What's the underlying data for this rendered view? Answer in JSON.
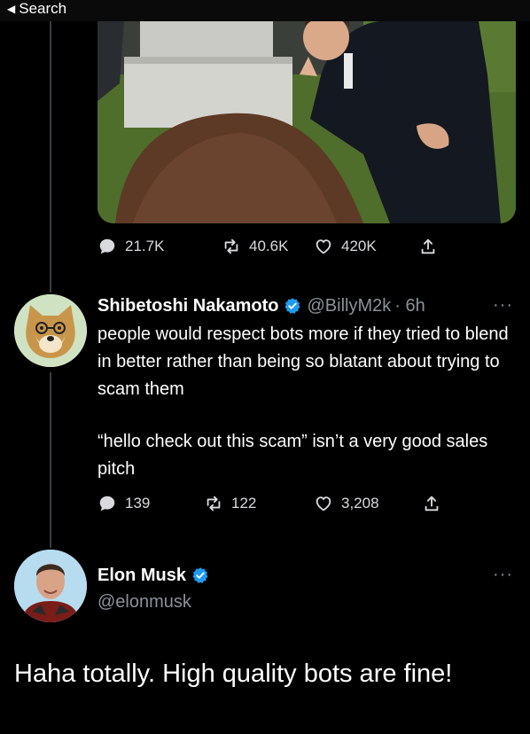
{
  "statusbar": {
    "back_label": "Search"
  },
  "first_tweet": {
    "stats": {
      "replies": "21.7K",
      "retweets": "40.6K",
      "likes": "420K"
    }
  },
  "reply_tweet": {
    "display_name": "Shibetoshi Nakamoto",
    "handle": "@BillyM2k",
    "time": "· 6h",
    "more": "···",
    "paragraph1": "people would respect bots more if they tried to blend in better rather than being so blatant about trying to scam them",
    "paragraph2": "“hello check out this scam” isn’t a very good sales pitch",
    "stats": {
      "replies": "139",
      "retweets": "122",
      "likes": "3,208"
    }
  },
  "main_tweet": {
    "display_name": "Elon Musk",
    "handle": "@elonmusk",
    "more": "···",
    "text": "Haha totally. High quality bots are fine!"
  },
  "colors": {
    "verified": "#1d9bf0",
    "muted": "#8b9198",
    "line": "#3a3d41"
  }
}
